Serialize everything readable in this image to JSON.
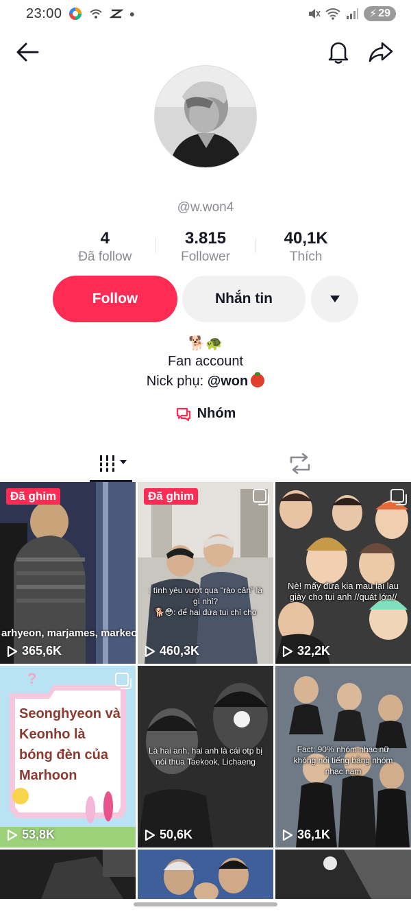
{
  "status_bar": {
    "time": "23:00",
    "battery": "29"
  },
  "profile": {
    "username": "@w.won4",
    "stats": [
      {
        "value": "4",
        "label": "Đã follow"
      },
      {
        "value": "3.815",
        "label": "Follower"
      },
      {
        "value": "40,1K",
        "label": "Thích"
      }
    ],
    "follow_label": "Follow",
    "message_label": "Nhắn tin",
    "bio_emoji": "🐕🐢",
    "bio_line1": "Fan account",
    "bio_line2_prefix": "Nick phụ: ",
    "bio_line2_handle": "@won",
    "group_label": "Nhóm"
  },
  "colors": {
    "accent": "#fe2c55",
    "text": "#161823",
    "muted": "#8a8b91",
    "button_gray": "#f1f1f2"
  },
  "videos": [
    {
      "views": "365,6K",
      "pinned": "Đã ghim",
      "caption": "arhyeon, marjames, markeo"
    },
    {
      "views": "460,3K",
      "pinned": "Đã ghim",
      "caption": ": tình yêu vượt qua \"rào cản\" là gì nhỉ?",
      "caption2": "🐕😳: để hai đứa tui chỉ cho"
    },
    {
      "views": "32,2K",
      "caption": "Nè! mấy đứa kia mau lại lau giày cho tụi anh //quát lớn//"
    },
    {
      "views": "53,8K",
      "caption": "Seonghyeon và Keonho là bóng đèn của Marhoon"
    },
    {
      "views": "50,6K",
      "caption": "Là hai anh, hai anh là cái otp bị nói thua Taekook, Lichaeng"
    },
    {
      "views": "36,1K",
      "caption": "Fact: 90% nhóm nhạc nữ không nổi tiếng bằng nhóm nhạc nam"
    }
  ]
}
